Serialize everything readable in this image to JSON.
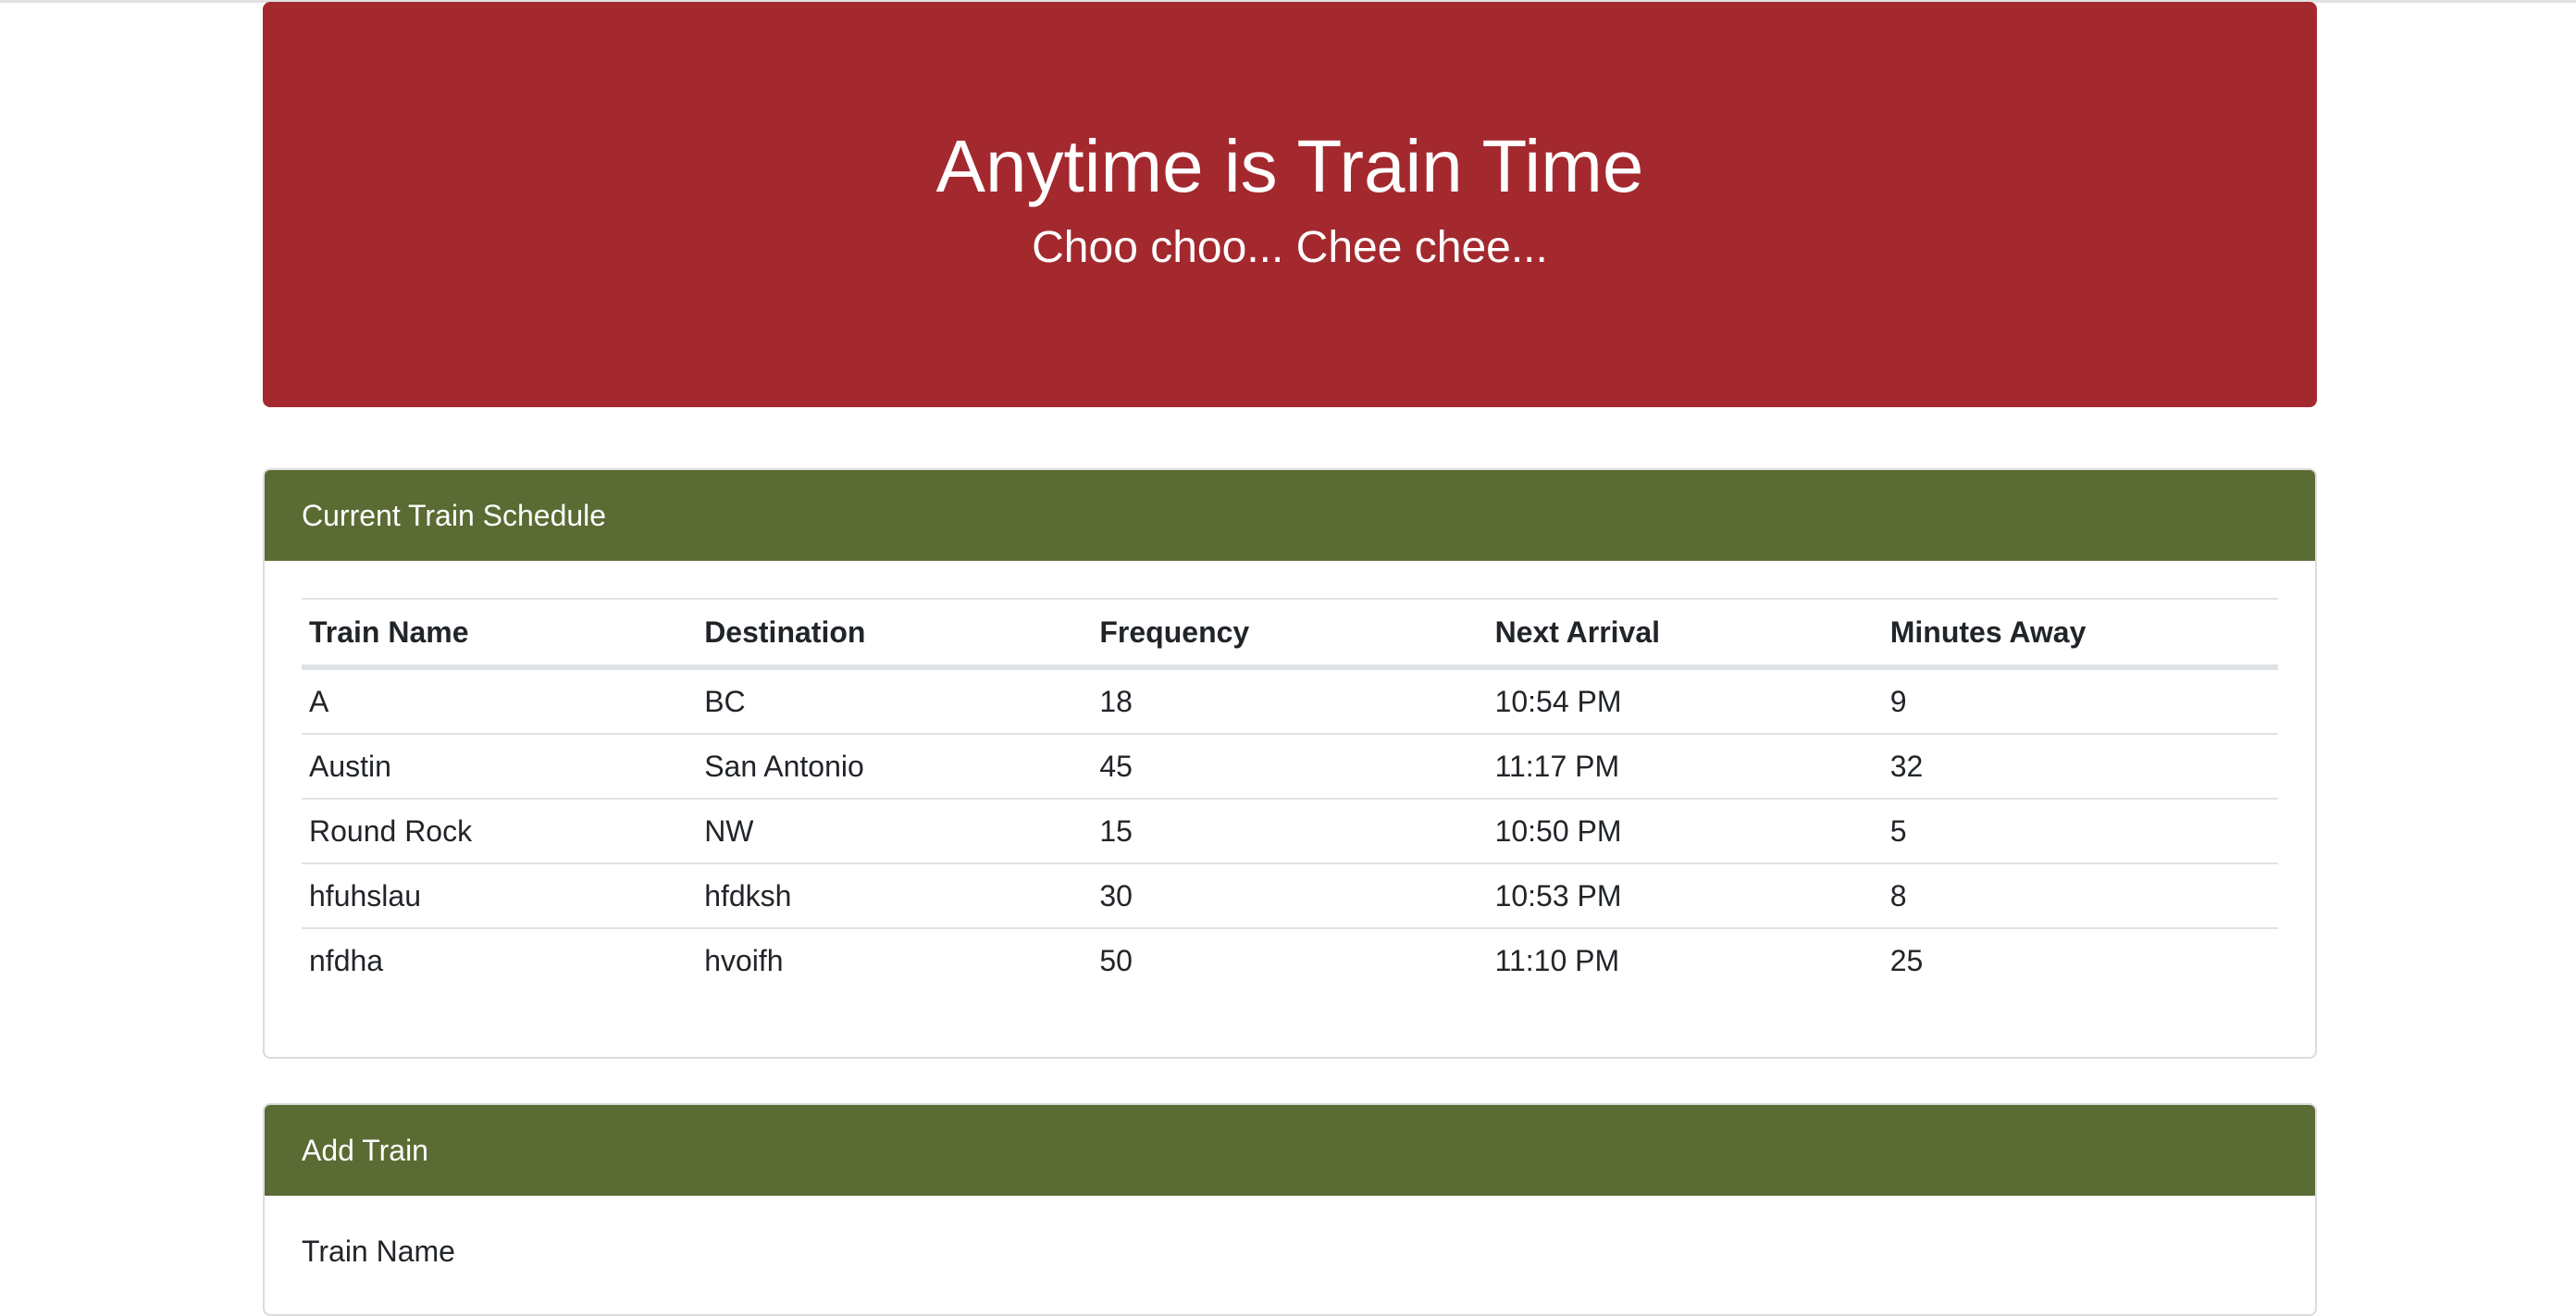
{
  "jumbotron": {
    "title": "Anytime is Train Time",
    "subtitle": "Choo choo... Chee chee..."
  },
  "schedule": {
    "header": "Current Train Schedule",
    "columns": [
      "Train Name",
      "Destination",
      "Frequency",
      "Next Arrival",
      "Minutes Away"
    ],
    "rows": [
      [
        "A",
        "BC",
        "18",
        "10:54 PM",
        "9"
      ],
      [
        "Austin",
        "San Antonio",
        "45",
        "11:17 PM",
        "32"
      ],
      [
        "Round Rock",
        "NW",
        "15",
        "10:50 PM",
        "5"
      ],
      [
        "hfuhslau",
        "hfdksh",
        "30",
        "10:53 PM",
        "8"
      ],
      [
        "nfdha",
        "hvoifh",
        "50",
        "11:10 PM",
        "25"
      ]
    ]
  },
  "add_train": {
    "header": "Add Train",
    "train_name_label": "Train Name"
  },
  "colors": {
    "jumbotron_bg": "#a3292e",
    "card_header_bg": "#5a6b33"
  }
}
